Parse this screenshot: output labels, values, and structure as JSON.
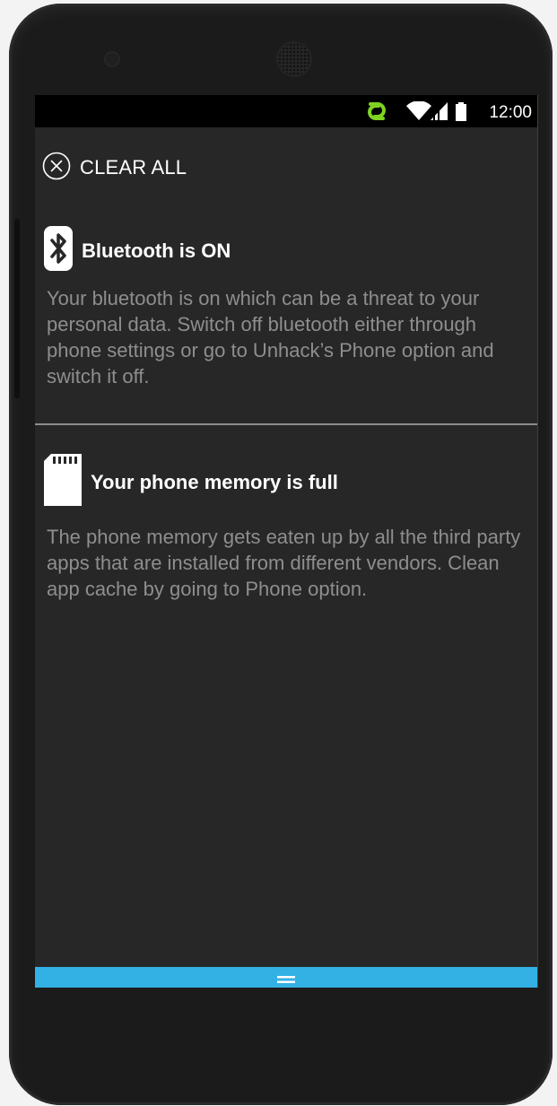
{
  "status_bar": {
    "time": "12:00",
    "icons": [
      "sync-link-icon",
      "wifi-icon",
      "signal-icon",
      "battery-icon"
    ],
    "sync_icon_color": "#7fd321"
  },
  "toolbar": {
    "clear_all_label": "CLEAR ALL"
  },
  "notifications": [
    {
      "icon": "bluetooth-icon",
      "title": "Bluetooth is ON",
      "body": "Your bluetooth is on which can be a threat to your personal data. Switch off bluetooth either through phone settings or go to Unhack’s Phone option and switch it off."
    },
    {
      "icon": "sd-card-icon",
      "title": "Your phone memory is full",
      "body": "The phone memory gets eaten up by all the third party apps that are installed from different vendors. Clean app cache by going to Phone option."
    }
  ],
  "bottom_bar": {
    "icon": "drag-handle-icon",
    "color": "#33b1e5"
  }
}
